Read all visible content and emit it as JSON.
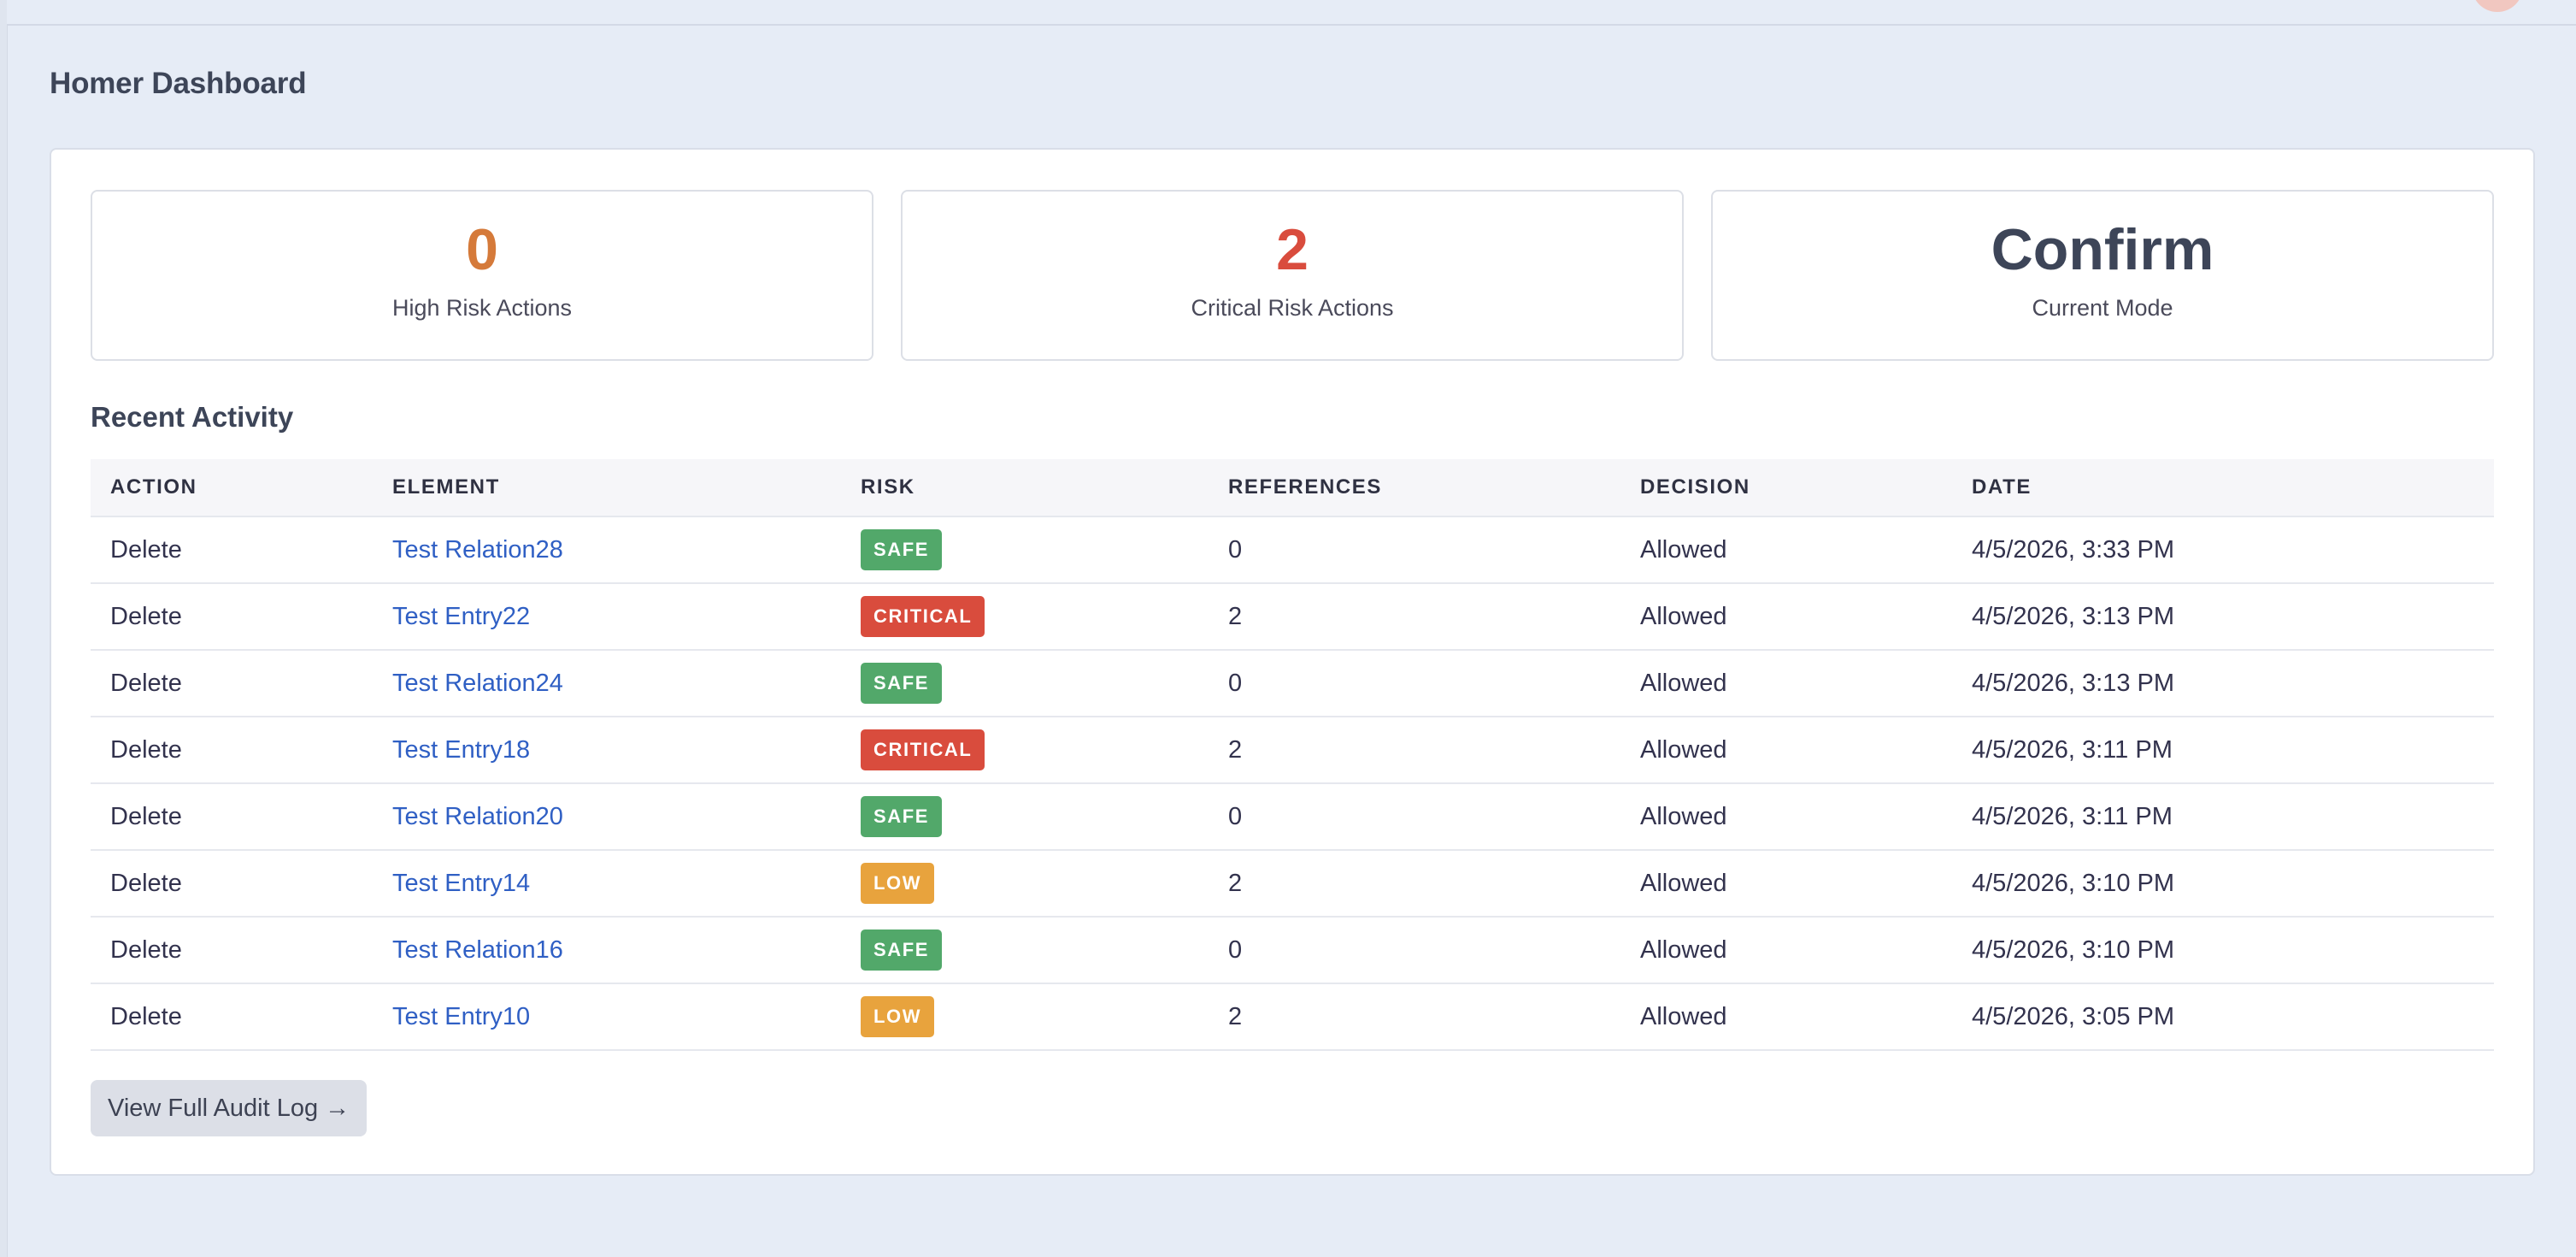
{
  "header": {
    "title": "Homer Dashboard"
  },
  "stats": [
    {
      "value": "0",
      "label": "High Risk Actions",
      "color": "#d57a3a"
    },
    {
      "value": "2",
      "label": "Critical Risk Actions",
      "color": "#d94c3d"
    },
    {
      "value": "Confirm",
      "label": "Current Mode",
      "color": "#3d4558"
    }
  ],
  "recent_activity": {
    "title": "Recent Activity",
    "columns": [
      "ACTION",
      "ELEMENT",
      "RISK",
      "REFERENCES",
      "DECISION",
      "DATE"
    ],
    "rows": [
      {
        "action": "Delete",
        "element": "Test Relation28",
        "risk": "SAFE",
        "risk_color": "#52a86a",
        "references": "0",
        "decision": "Allowed",
        "date": "4/5/2026, 3:33 PM"
      },
      {
        "action": "Delete",
        "element": "Test Entry22",
        "risk": "CRITICAL",
        "risk_color": "#d94c3d",
        "references": "2",
        "decision": "Allowed",
        "date": "4/5/2026, 3:13 PM"
      },
      {
        "action": "Delete",
        "element": "Test Relation24",
        "risk": "SAFE",
        "risk_color": "#52a86a",
        "references": "0",
        "decision": "Allowed",
        "date": "4/5/2026, 3:13 PM"
      },
      {
        "action": "Delete",
        "element": "Test Entry18",
        "risk": "CRITICAL",
        "risk_color": "#d94c3d",
        "references": "2",
        "decision": "Allowed",
        "date": "4/5/2026, 3:11 PM"
      },
      {
        "action": "Delete",
        "element": "Test Relation20",
        "risk": "SAFE",
        "risk_color": "#52a86a",
        "references": "0",
        "decision": "Allowed",
        "date": "4/5/2026, 3:11 PM"
      },
      {
        "action": "Delete",
        "element": "Test Entry14",
        "risk": "LOW",
        "risk_color": "#e8a33d",
        "references": "2",
        "decision": "Allowed",
        "date": "4/5/2026, 3:10 PM"
      },
      {
        "action": "Delete",
        "element": "Test Relation16",
        "risk": "SAFE",
        "risk_color": "#52a86a",
        "references": "0",
        "decision": "Allowed",
        "date": "4/5/2026, 3:10 PM"
      },
      {
        "action": "Delete",
        "element": "Test Entry10",
        "risk": "LOW",
        "risk_color": "#e8a33d",
        "references": "2",
        "decision": "Allowed",
        "date": "4/5/2026, 3:05 PM"
      }
    ]
  },
  "footer": {
    "audit_button_label": "View Full Audit Log →"
  }
}
